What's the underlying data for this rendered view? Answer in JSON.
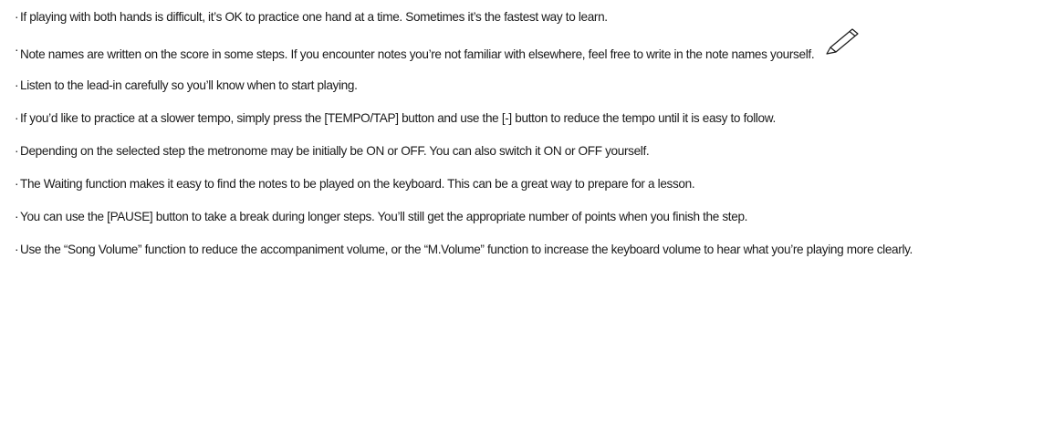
{
  "bullet": "·",
  "tips": [
    "If playing with both hands is difficult, it’s OK to practice one hand at a time. Sometimes it’s the fastest way to learn.",
    "Note names are written on the score in some steps. If you encounter notes you’re not familiar with elsewhere, feel free to write in the note names yourself.",
    "Listen to the lead-in carefully so you’ll know when to start playing.",
    "If you’d like to practice at a slower tempo, simply press the [TEMPO/TAP] button and use the [-] button to reduce the tempo until it is easy to follow.",
    "Depending on the selected step the metronome may be initially be ON or OFF. You can also switch it ON or OFF yourself.",
    "The Waiting function makes it easy to find the notes to be played on the keyboard. This can be a great way to prepare for a lesson.",
    "You can use the [PAUSE] button to take a break during longer steps. You’ll still get the appropriate number of points when you finish the step.",
    "Use the “Song Volume” function to reduce the accompaniment volume, or the “M.Volume” function to increase the keyboard volume to hear what you’re playing more clearly."
  ],
  "icons": {
    "pencil": "pencil-icon"
  }
}
